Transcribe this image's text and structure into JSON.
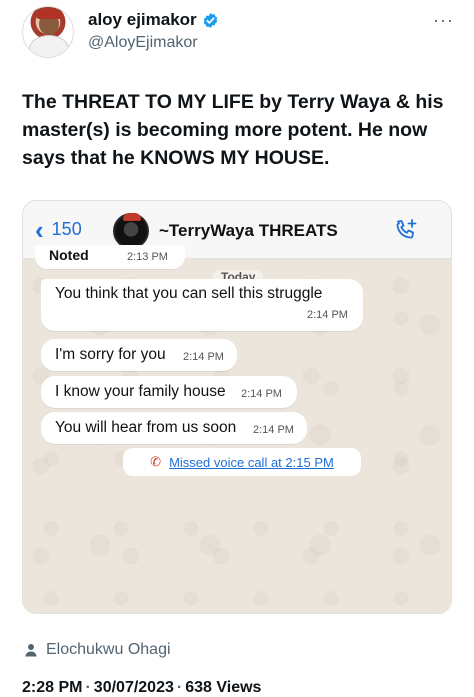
{
  "tweet": {
    "display_name": "aloy ejimakor",
    "handle": "@AloyEjimakor",
    "more": "···",
    "text": "The THREAT TO MY LIFE by Terry Waya & his master(s) is becoming more potent. He now says that he KNOWS MY HOUSE.",
    "verified_color": "#1d9bf0"
  },
  "screenshot": {
    "back_count": "150",
    "chat_title": "~TerryWaya THREATS",
    "date_divider": "Today",
    "messages": [
      {
        "text": "Noted",
        "time": "2:13 PM"
      },
      {
        "text": "You think that you can sell this struggle",
        "time": "2:14 PM"
      },
      {
        "text": "I'm sorry for you",
        "time": "2:14 PM"
      },
      {
        "text": "I know your family house",
        "time": "2:14 PM"
      },
      {
        "text": "You will hear from us soon",
        "time": "2:14 PM"
      }
    ],
    "missed_call": "Missed voice call at 2:15 PM",
    "accent": "#1f6fd6",
    "missed_color": "#d93a2b"
  },
  "footer": {
    "author": "Elochukwu Ohagi",
    "time": "2:28 PM",
    "date": "30/07/2023",
    "views_count": "638",
    "views_label": "Views"
  }
}
